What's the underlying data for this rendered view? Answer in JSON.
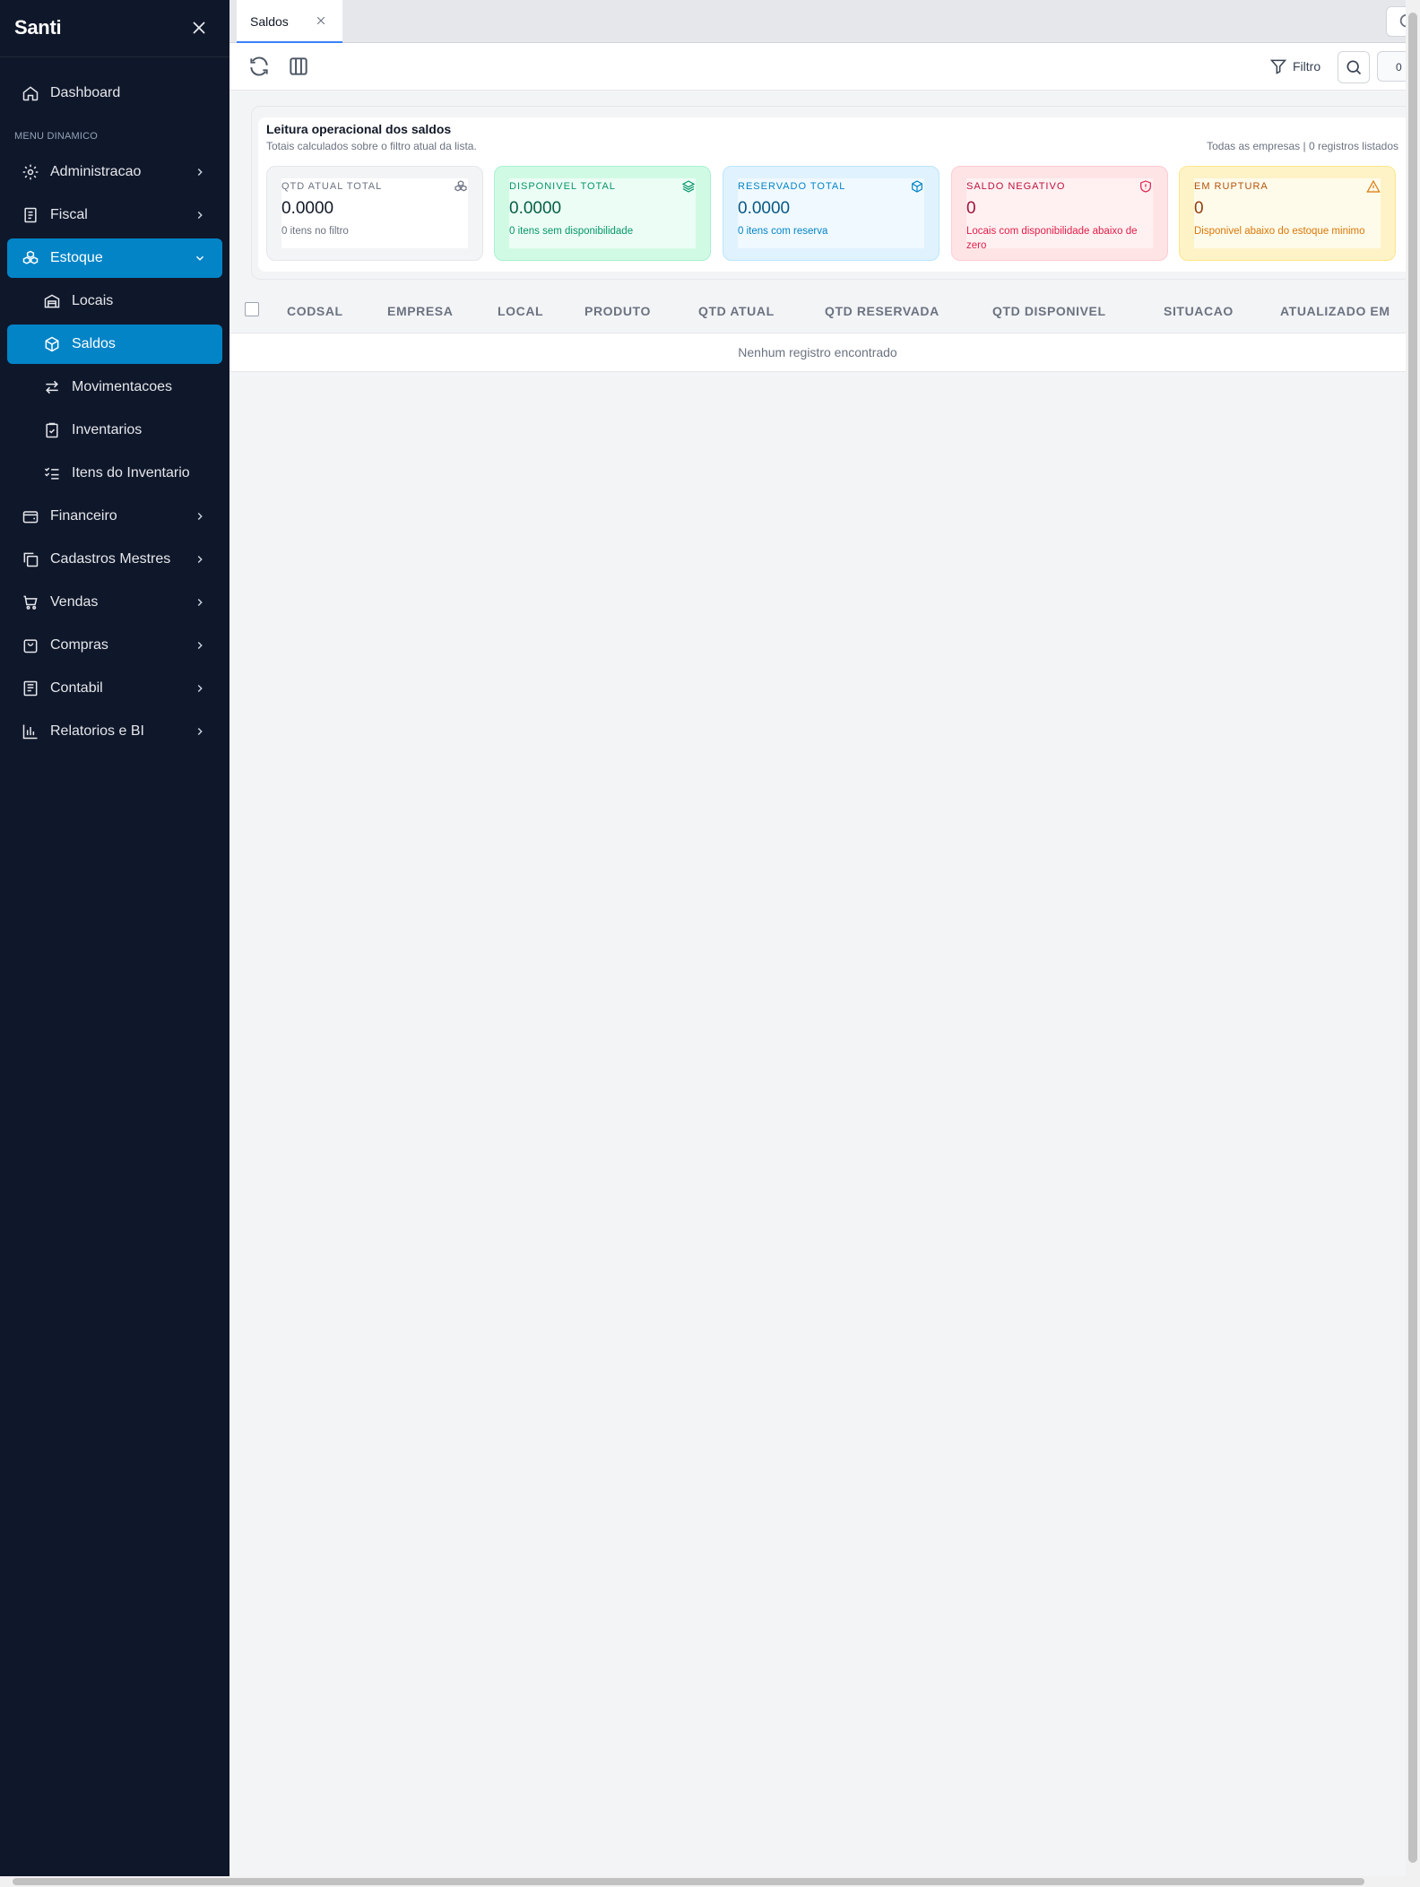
{
  "app": {
    "brand": "Santi"
  },
  "sidebar": {
    "section_label": "MENU DINAMICO",
    "items": [
      {
        "label": "Dashboard",
        "icon": "home-icon"
      },
      {
        "label": "Administracao",
        "icon": "gear-icon"
      },
      {
        "label": "Fiscal",
        "icon": "receipt-icon"
      },
      {
        "label": "Estoque",
        "icon": "boxes-icon"
      },
      {
        "label": "Locais",
        "icon": "warehouse-icon"
      },
      {
        "label": "Saldos",
        "icon": "package-icon"
      },
      {
        "label": "Movimentacoes",
        "icon": "arrows-swap-icon"
      },
      {
        "label": "Inventarios",
        "icon": "clipboard-check-icon"
      },
      {
        "label": "Itens do Inventario",
        "icon": "list-checks-icon"
      },
      {
        "label": "Financeiro",
        "icon": "wallet-icon"
      },
      {
        "label": "Cadastros Mestres",
        "icon": "copy-icon"
      },
      {
        "label": "Vendas",
        "icon": "cart-icon"
      },
      {
        "label": "Compras",
        "icon": "shopping-bag-icon"
      },
      {
        "label": "Contabil",
        "icon": "book-icon"
      },
      {
        "label": "Relatorios e BI",
        "icon": "bar-chart-icon"
      }
    ]
  },
  "tabs": [
    {
      "label": "Saldos",
      "active": true
    }
  ],
  "toolbar": {
    "filter_label": "Filtro",
    "count": "0"
  },
  "summary": {
    "title": "Leitura operacional dos saldos",
    "subtitle": "Totais calculados sobre o filtro atual da lista.",
    "context": "Todas as empresas | 0 registros listados",
    "cards": [
      {
        "title": "QTD ATUAL TOTAL",
        "value": "0.0000",
        "footer": "0 itens no filtro",
        "icon": "boxes-icon"
      },
      {
        "title": "DISPONIVEL TOTAL",
        "value": "0.0000",
        "footer": "0 itens sem disponibilidade",
        "icon": "layers-icon"
      },
      {
        "title": "RESERVADO TOTAL",
        "value": "0.0000",
        "footer": "0 itens com reserva",
        "icon": "package-icon"
      },
      {
        "title": "SALDO NEGATIVO",
        "value": "0",
        "footer": "Locais com disponibilidade abaixo de zero",
        "icon": "shield-alert-icon"
      },
      {
        "title": "EM RUPTURA",
        "value": "0",
        "footer": "Disponivel abaixo do estoque minimo",
        "icon": "warning-triangle-icon"
      }
    ]
  },
  "table": {
    "columns": [
      "CODSAL",
      "EMPRESA",
      "LOCAL",
      "PRODUTO",
      "QTD ATUAL",
      "QTD RESERVADA",
      "QTD DISPONIVEL",
      "SITUACAO",
      "ATUALIZADO EM"
    ],
    "empty_message": "Nenhum registro encontrado"
  },
  "colors": {
    "sidebar_bg": "#0f172a",
    "accent": "#0284c7",
    "tab_underline": "#3b82f6"
  }
}
